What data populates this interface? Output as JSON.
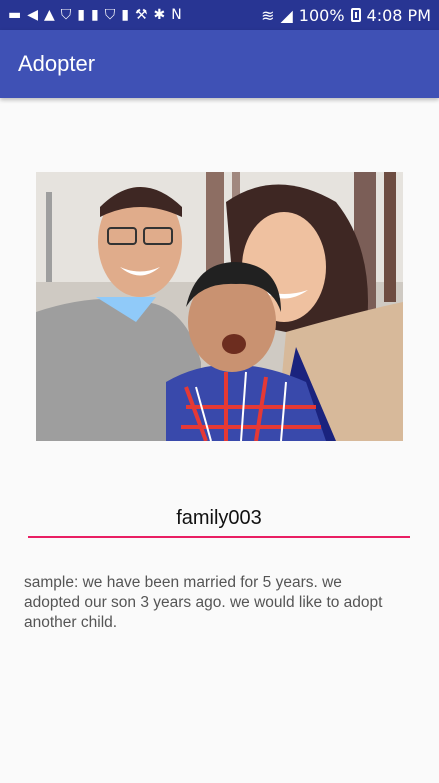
{
  "status_bar": {
    "icons": [
      "message-icon",
      "play-icon",
      "warning-icon",
      "shield-icon",
      "usb-icon",
      "usb-icon",
      "shield-icon",
      "usb-icon",
      "wrench-icon",
      "bluetooth-icon",
      "nfc-icon",
      "wifi-icon",
      "signal-icon"
    ],
    "battery_percent": "100%",
    "time": "4:08 PM",
    "background_color": "#283593"
  },
  "app_bar": {
    "title": "Adopter",
    "background_color": "#3f51b5"
  },
  "profile": {
    "photo_description_icon": "family-photo",
    "family_name": "family003",
    "underline_color": "#e91e63",
    "description": "sample: we have been married for 5 years. we adopted our son 3 years ago. we would like to adopt another child."
  }
}
